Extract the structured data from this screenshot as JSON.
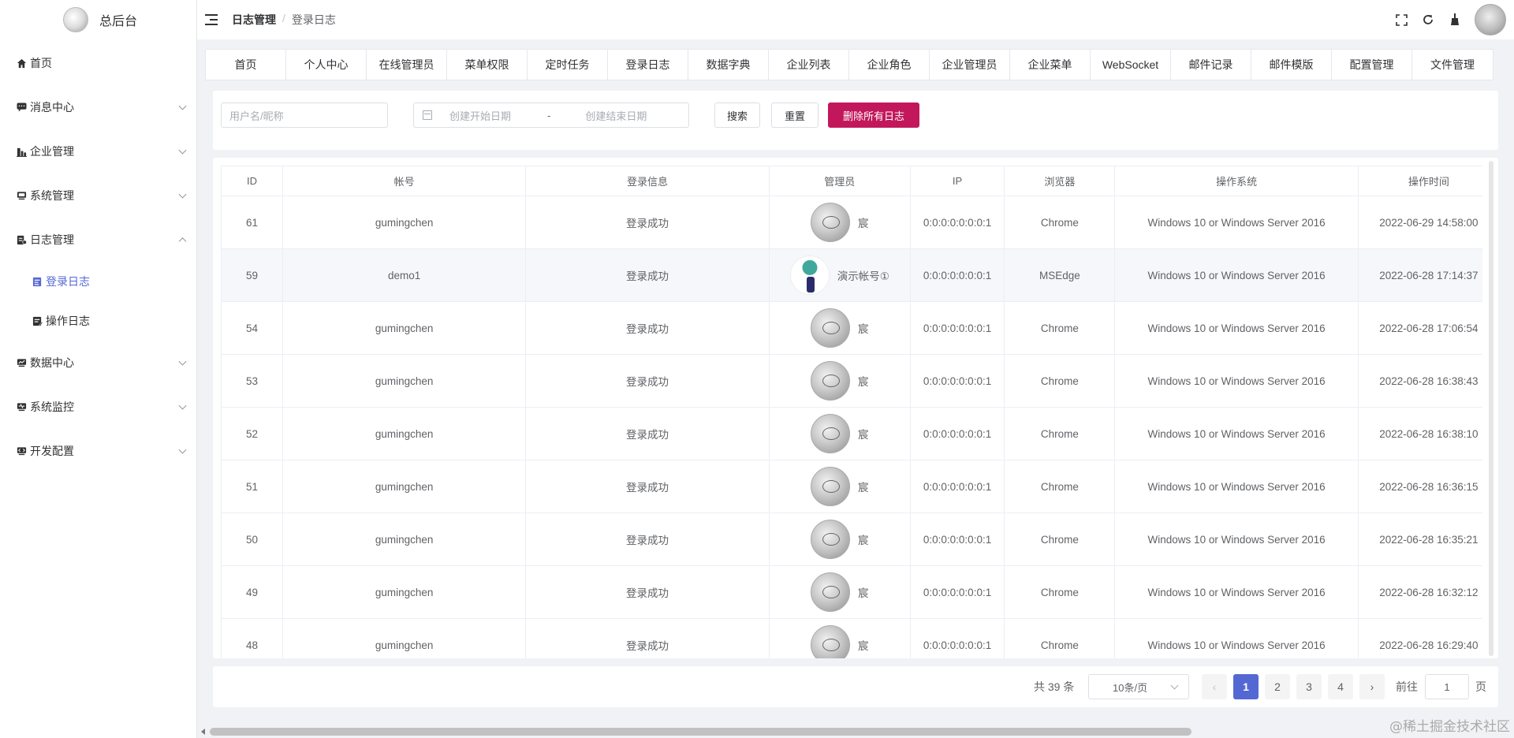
{
  "app": {
    "title": "总后台"
  },
  "sidebar": {
    "items": [
      {
        "label": "首页",
        "icon": "home-icon"
      },
      {
        "label": "消息中心",
        "icon": "message-icon"
      },
      {
        "label": "企业管理",
        "icon": "enterprise-icon"
      },
      {
        "label": "系统管理",
        "icon": "system-icon"
      },
      {
        "label": "日志管理",
        "icon": "log-icon",
        "expanded": true,
        "children": [
          {
            "label": "登录日志",
            "icon": "document-icon",
            "active": true
          },
          {
            "label": "操作日志",
            "icon": "document-edit-icon"
          }
        ]
      },
      {
        "label": "数据中心",
        "icon": "data-icon"
      },
      {
        "label": "系统监控",
        "icon": "monitor-icon"
      },
      {
        "label": "开发配置",
        "icon": "dev-config-icon"
      }
    ]
  },
  "breadcrumb": {
    "parent": "日志管理",
    "separator": "/",
    "current": "登录日志"
  },
  "tags": [
    "首页",
    "个人中心",
    "在线管理员",
    "菜单权限",
    "定时任务",
    "登录日志",
    "数据字典",
    "企业列表",
    "企业角色",
    "企业管理员",
    "企业菜单",
    "WebSocket",
    "邮件记录",
    "邮件模版",
    "配置管理",
    "文件管理"
  ],
  "search": {
    "user_placeholder": "用户名/昵称",
    "start_placeholder": "创建开始日期",
    "range_separator": "-",
    "end_placeholder": "创建结束日期",
    "search_label": "搜索",
    "reset_label": "重置",
    "delete_all_label": "删除所有日志"
  },
  "table": {
    "headers": [
      "ID",
      "帐号",
      "登录信息",
      "管理员",
      "IP",
      "浏览器",
      "操作系统",
      "操作时间"
    ],
    "rows": [
      {
        "id": "61",
        "account": "gumingchen",
        "info": "登录成功",
        "admin": "宸",
        "ip": "0:0:0:0:0:0:0:1",
        "browser": "Chrome",
        "os": "Windows 10 or Windows Server 2016",
        "time": "2022-06-29 14:58:00"
      },
      {
        "id": "59",
        "account": "demo1",
        "info": "登录成功",
        "admin": "演示帐号①",
        "ip": "0:0:0:0:0:0:0:1",
        "browser": "MSEdge",
        "os": "Windows 10 or Windows Server 2016",
        "time": "2022-06-28 17:14:37"
      },
      {
        "id": "54",
        "account": "gumingchen",
        "info": "登录成功",
        "admin": "宸",
        "ip": "0:0:0:0:0:0:0:1",
        "browser": "Chrome",
        "os": "Windows 10 or Windows Server 2016",
        "time": "2022-06-28 17:06:54"
      },
      {
        "id": "53",
        "account": "gumingchen",
        "info": "登录成功",
        "admin": "宸",
        "ip": "0:0:0:0:0:0:0:1",
        "browser": "Chrome",
        "os": "Windows 10 or Windows Server 2016",
        "time": "2022-06-28 16:38:43"
      },
      {
        "id": "52",
        "account": "gumingchen",
        "info": "登录成功",
        "admin": "宸",
        "ip": "0:0:0:0:0:0:0:1",
        "browser": "Chrome",
        "os": "Windows 10 or Windows Server 2016",
        "time": "2022-06-28 16:38:10"
      },
      {
        "id": "51",
        "account": "gumingchen",
        "info": "登录成功",
        "admin": "宸",
        "ip": "0:0:0:0:0:0:0:1",
        "browser": "Chrome",
        "os": "Windows 10 or Windows Server 2016",
        "time": "2022-06-28 16:36:15"
      },
      {
        "id": "50",
        "account": "gumingchen",
        "info": "登录成功",
        "admin": "宸",
        "ip": "0:0:0:0:0:0:0:1",
        "browser": "Chrome",
        "os": "Windows 10 or Windows Server 2016",
        "time": "2022-06-28 16:35:21"
      },
      {
        "id": "49",
        "account": "gumingchen",
        "info": "登录成功",
        "admin": "宸",
        "ip": "0:0:0:0:0:0:0:1",
        "browser": "Chrome",
        "os": "Windows 10 or Windows Server 2016",
        "time": "2022-06-28 16:32:12"
      },
      {
        "id": "48",
        "account": "gumingchen",
        "info": "登录成功",
        "admin": "宸",
        "ip": "0:0:0:0:0:0:0:1",
        "browser": "Chrome",
        "os": "Windows 10 or Windows Server 2016",
        "time": "2022-06-28 16:29:40"
      }
    ]
  },
  "pagination": {
    "total": "共 39 条",
    "page_size": "10条/页",
    "pages": [
      "1",
      "2",
      "3",
      "4"
    ],
    "current": "1",
    "goto_label": "前往",
    "goto_value": "1",
    "page_suffix": "页"
  },
  "colors": {
    "accent": "#5468d4",
    "danger": "#c2185b"
  },
  "watermark": "@稀土掘金技术社区"
}
